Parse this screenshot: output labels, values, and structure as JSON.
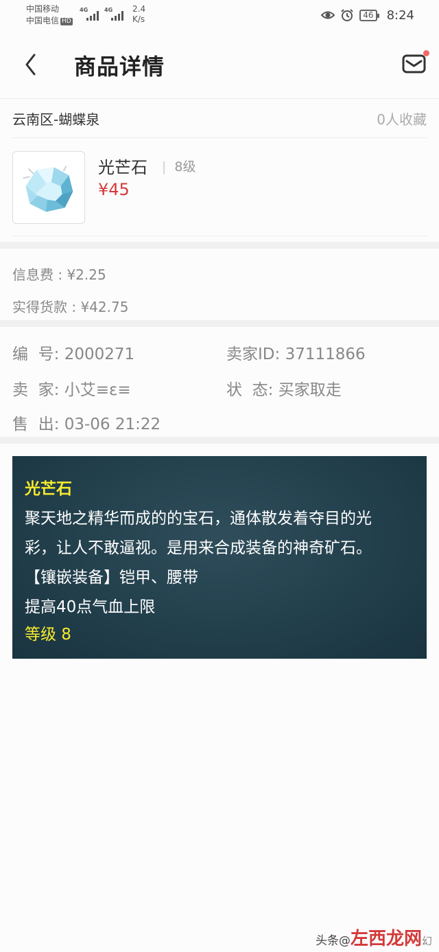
{
  "status_bar": {
    "carrier_1": "中国移动",
    "carrier_2": "中国电信",
    "hd_badge": "HD",
    "net_1": "4G",
    "net_2": "4G",
    "speed_value": "2.4",
    "speed_unit": "K/s",
    "battery": "46",
    "time": "8:24",
    "icons": [
      "eye-icon",
      "alarm-icon"
    ]
  },
  "header": {
    "back_icon": "chevron-left-icon",
    "title": "商品详情",
    "message_icon": "mail-icon",
    "has_unread": true
  },
  "listing": {
    "server": "云南区-蝴蝶泉",
    "favorites": "0人收藏"
  },
  "item": {
    "name": "光芒石",
    "separator": "|",
    "level": "8级",
    "price": "¥45",
    "thumbnail_icon": "gem-icon"
  },
  "fees": {
    "info_fee": "信息费 : ¥2.25",
    "net_payment": "实得货款 : ¥42.75"
  },
  "details": {
    "number_label": "编  号:",
    "number_value": "2000271",
    "seller_id_label": "卖家ID:",
    "seller_id_value": "37111866",
    "seller_label": "卖  家:",
    "seller_value": "小艾≡ε≡",
    "status_label": "状  态:",
    "status_value": "买家取走",
    "sold_label": "售  出:",
    "sold_value": "03-06 21:22"
  },
  "description": {
    "title": "光芒石",
    "line_1": "聚天地之精华而成的的宝石，通体散发着夺目的光",
    "line_2": "彩，让人不敢逼视。是用来合成装备的神奇矿石。",
    "line_3": "【镶嵌装备】铠甲、腰带",
    "line_4": "提高40点气血上限",
    "level": "等级 8",
    "title_color": "#f7ec2b",
    "panel_color": "#223f4c"
  },
  "watermark": {
    "prefix": "头条@",
    "brand": "左西龙网",
    "suffix": "幻"
  },
  "colors": {
    "price": "#d33a3a",
    "background": "#fcfcfc",
    "divider": "#f0f0f0"
  }
}
